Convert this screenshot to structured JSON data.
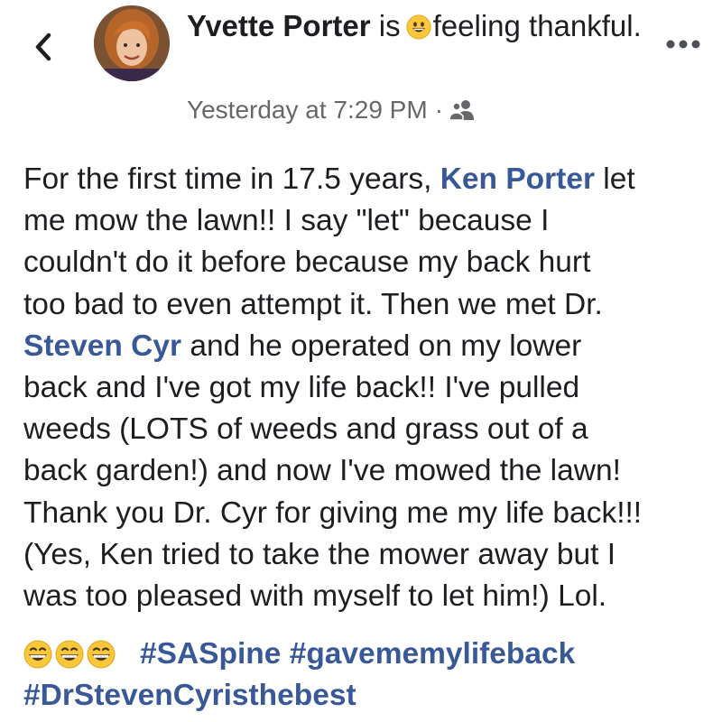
{
  "header": {
    "author_name": "Yvette Porter",
    "activity_prefix": "is",
    "activity_text": "feeling thankful.",
    "activity_icon": "grinning-face-icon",
    "timestamp": "Yesterday at 7:29 PM",
    "separator": "·",
    "audience_icon": "friends-icon"
  },
  "icons": {
    "back": "chevron-left-icon",
    "more": "more-dots-icon"
  },
  "post": {
    "segments": {
      "s1": "For the first time in 17.5 years, ",
      "mention1": "Ken Porter",
      "s2": " let\nme mow the lawn!!  I say \"let\" because I\ncouldn't do it before because my back hurt\ntoo bad to even attempt it.  Then we met Dr.\n",
      "mention2": "Steven Cyr",
      "s3": " and he operated on my lower\nback and I've got my life back!!  I've pulled\nweeds (LOTS of weeds and grass out of a\nback garden!) and now I've mowed the lawn!\nThank you Dr. Cyr for giving me my life back!!!\n(Yes, Ken tried to take the mower away but I\nwas too pleased with myself to let him!)  Lol."
    },
    "emoji_icon": "grinning-squinting-face-icon",
    "hashtags": [
      "#SASpine",
      "#gavememylifeback",
      "#DrStevenCyristhebest"
    ]
  },
  "colors": {
    "link": "#385898",
    "text": "#1c1e21",
    "secondary": "#65676b"
  }
}
